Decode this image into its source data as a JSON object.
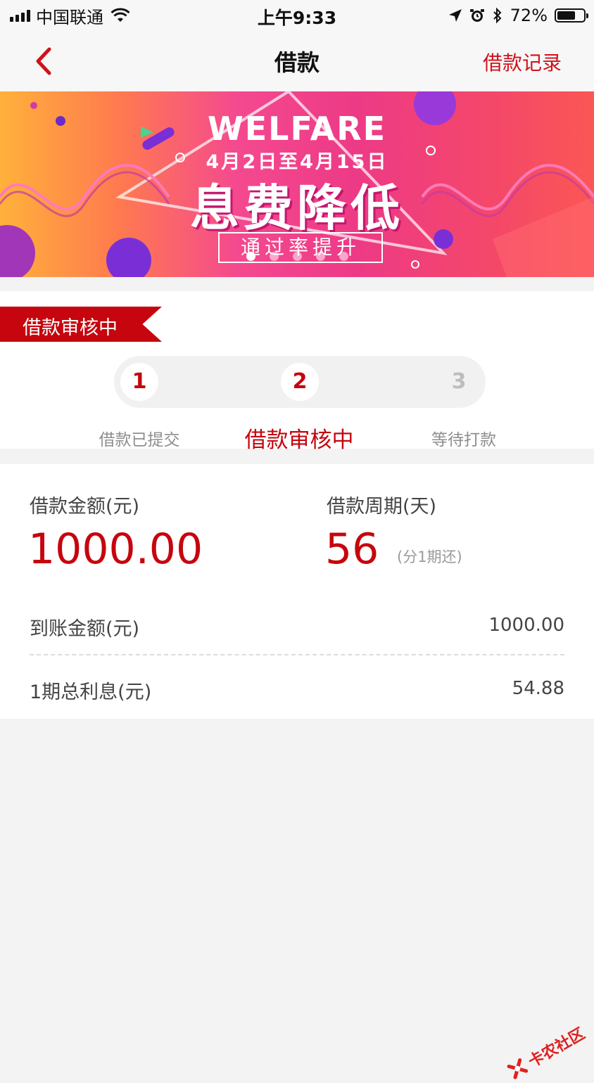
{
  "status_bar": {
    "carrier": "中国联通",
    "time": "上午9:33",
    "battery": "72%",
    "battery_level": 0.72,
    "icons": [
      "signal-icon",
      "wifi-icon",
      "location-icon",
      "alarm-icon",
      "bluetooth-icon",
      "battery-icon"
    ]
  },
  "nav": {
    "title": "借款",
    "right_link": "借款记录",
    "back_icon": "chevron-left-icon"
  },
  "banner": {
    "welfare": "WELFARE",
    "dates": "4月2日至4月15日",
    "headline": "息费降低",
    "tag": "通过率提升",
    "slide_count": 5,
    "active_slide": 1
  },
  "progress": {
    "status_badge": "借款审核中",
    "steps": [
      {
        "number": "1",
        "label": "借款已提交",
        "state": "done"
      },
      {
        "number": "2",
        "label": "借款审核中",
        "state": "current"
      },
      {
        "number": "3",
        "label": "等待打款",
        "state": "pending"
      }
    ]
  },
  "loan": {
    "amount_label": "借款金额(元)",
    "amount_value": "1000.00",
    "period_label": "借款周期(天)",
    "period_value": "56",
    "period_note": "(分1期还)",
    "rows": [
      {
        "label": "到账金额(元)",
        "value": "1000.00"
      },
      {
        "label": "1期总利息(元)",
        "value": "54.88"
      }
    ]
  },
  "watermark": {
    "text": "卡农社区"
  },
  "colors": {
    "brand_red": "#c6050e",
    "link_red": "#d0121b",
    "page_bg": "#f3f3f3"
  }
}
